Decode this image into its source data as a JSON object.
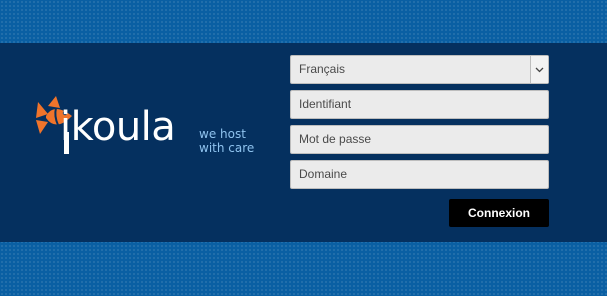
{
  "brand": {
    "name": "ikoula",
    "tagline_line1": "we host",
    "tagline_line2": "with care",
    "logo_icon": "fish-icon",
    "colors": {
      "fish": "#f0742b",
      "tagline": "#8fc3ef",
      "band": "#05305f",
      "background": "#0a5fa3"
    }
  },
  "login": {
    "language": {
      "value": "Français",
      "icon": "chevron-down-icon"
    },
    "identifier": {
      "placeholder": "Identifiant"
    },
    "password": {
      "placeholder": "Mot de passe"
    },
    "domain": {
      "placeholder": "Domaine"
    },
    "submit_label": "Connexion"
  }
}
